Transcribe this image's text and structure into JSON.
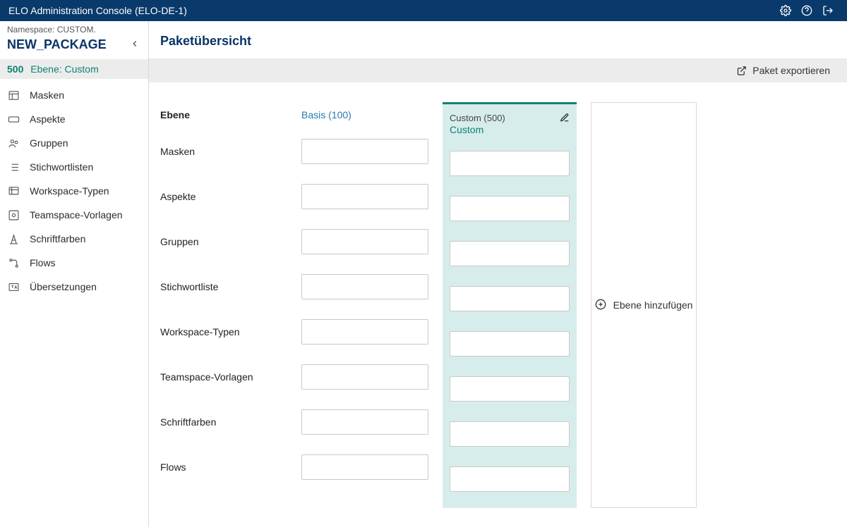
{
  "header": {
    "title": "ELO Administration Console (ELO-DE-1)"
  },
  "sidebar": {
    "namespace_label": "Namespace: CUSTOM.",
    "package_name": "NEW_PACKAGE",
    "level_code": "500",
    "level_name": "Ebene: Custom",
    "items": [
      {
        "label": "Masken",
        "icon": "masks-icon"
      },
      {
        "label": "Aspekte",
        "icon": "aspects-icon"
      },
      {
        "label": "Gruppen",
        "icon": "groups-icon"
      },
      {
        "label": "Stichwortlisten",
        "icon": "keyword-lists-icon"
      },
      {
        "label": "Workspace-Typen",
        "icon": "workspace-types-icon"
      },
      {
        "label": "Teamspace-Vorlagen",
        "icon": "teamspace-templates-icon"
      },
      {
        "label": "Schriftfarben",
        "icon": "font-colors-icon"
      },
      {
        "label": "Flows",
        "icon": "flows-icon"
      },
      {
        "label": "Übersetzungen",
        "icon": "translations-icon"
      }
    ]
  },
  "main": {
    "page_title": "Paketübersicht",
    "actions": {
      "export_label": "Paket exportieren"
    },
    "rows_header": "Ebene",
    "rows": [
      "Masken",
      "Aspekte",
      "Gruppen",
      "Stichwortliste",
      "Workspace-Typen",
      "Teamspace-Vorlagen",
      "Schriftfarben",
      "Flows"
    ],
    "basis_column_label": "Basis (100)",
    "custom": {
      "subtitle": "Custom (500)",
      "name": "Custom"
    },
    "add_level_label": "Ebene hinzufügen"
  }
}
